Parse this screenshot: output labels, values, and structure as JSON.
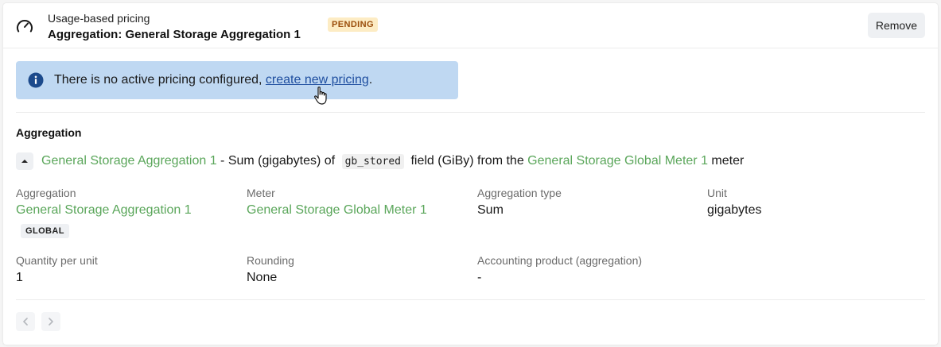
{
  "header": {
    "subtitle": "Usage-based pricing",
    "title": "Aggregation: General Storage Aggregation 1",
    "status_badge": "PENDING",
    "remove_label": "Remove"
  },
  "info_banner": {
    "text": "There is no active pricing configured, ",
    "link_text": "create new pricing",
    "suffix": "."
  },
  "aggregation_section": {
    "title": "Aggregation",
    "summary": {
      "aggregation_link": "General Storage Aggregation 1",
      "text_1": " - Sum (gigabytes) of ",
      "field_code": "gb_stored",
      "text_2": " field (GiBy) from the ",
      "meter_link": "General Storage Global Meter 1",
      "text_3": " meter"
    },
    "fields": {
      "aggregation": {
        "label": "Aggregation",
        "value": "General Storage Aggregation 1",
        "badge": "GLOBAL"
      },
      "meter": {
        "label": "Meter",
        "value": "General Storage Global Meter 1"
      },
      "aggregation_type": {
        "label": "Aggregation type",
        "value": "Sum"
      },
      "unit": {
        "label": "Unit",
        "value": "gigabytes"
      },
      "quantity_per_unit": {
        "label": "Quantity per unit",
        "value": "1"
      },
      "rounding": {
        "label": "Rounding",
        "value": "None"
      },
      "accounting_product": {
        "label": "Accounting product (aggregation)",
        "value": "-"
      }
    }
  },
  "colors": {
    "link_green": "#5aa65a",
    "info_bg": "#bfd8f2",
    "pending_bg": "#fdecc4",
    "pending_text": "#9a4d0b"
  }
}
